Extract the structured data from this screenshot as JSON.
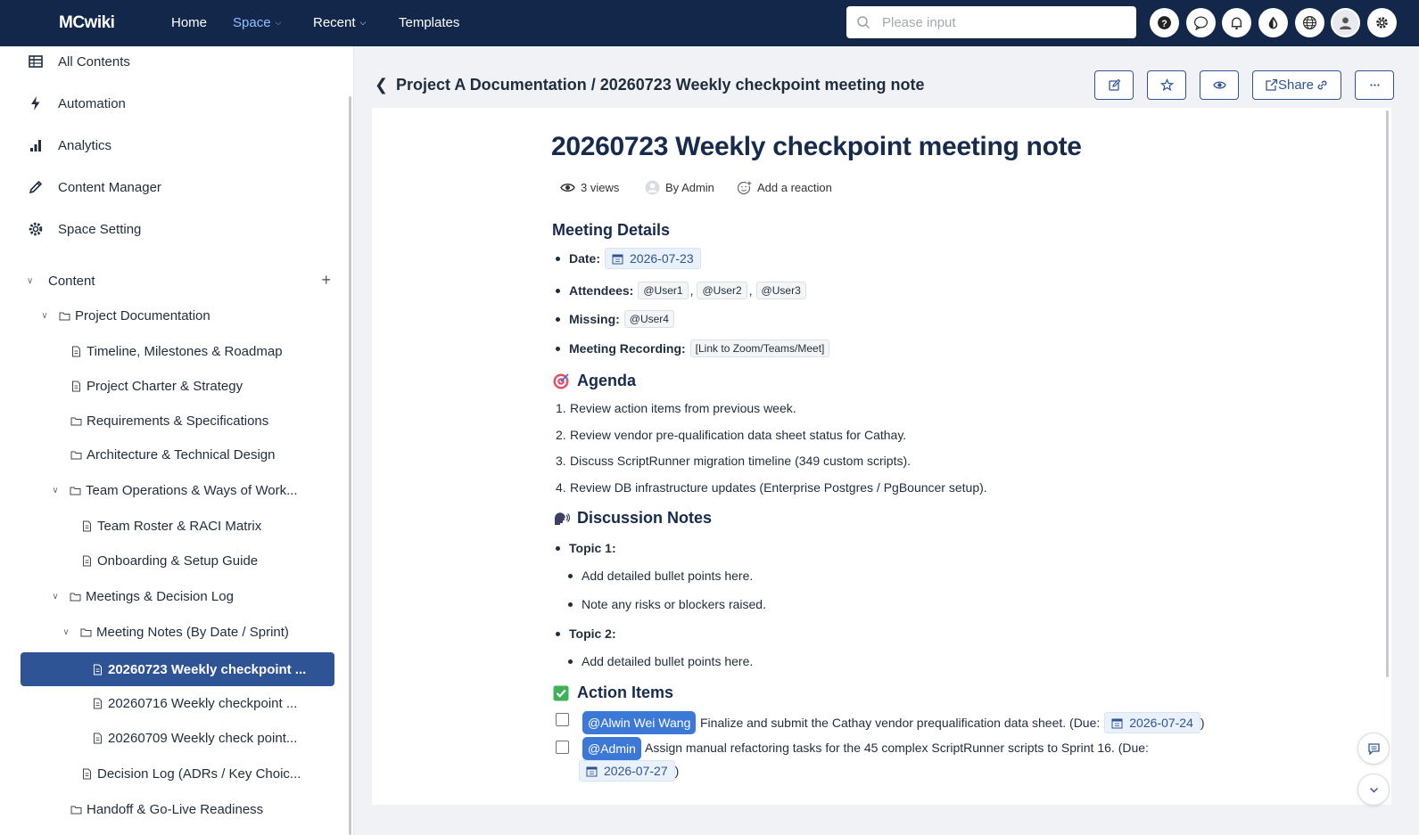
{
  "app": {
    "logo": "MCwiki"
  },
  "nav": {
    "home": "Home",
    "space": "Space",
    "recent": "Recent",
    "templates": "Templates"
  },
  "search": {
    "placeholder": "Please input"
  },
  "topbar_icons": [
    "help-icon",
    "chat-bubble-icon",
    "bell-icon",
    "theme-drop-icon",
    "globe-icon",
    "user-avatar",
    "gear-icon"
  ],
  "sidebar": {
    "menu": [
      {
        "label": "All Contents",
        "icon": "table-icon"
      },
      {
        "label": "Automation",
        "icon": "lightning-icon"
      },
      {
        "label": "Analytics",
        "icon": "bar-chart-icon"
      },
      {
        "label": "Content Manager",
        "icon": "pencil-icon"
      },
      {
        "label": "Space Setting",
        "icon": "gear-icon"
      }
    ],
    "content_header": "Content",
    "tree": [
      {
        "label": "Project Documentation",
        "type": "folder"
      },
      {
        "label": "Timeline, Milestones & Roadmap",
        "type": "page"
      },
      {
        "label": "Project Charter & Strategy",
        "type": "page"
      },
      {
        "label": "Requirements & Specifications",
        "type": "folder"
      },
      {
        "label": "Architecture & Technical Design",
        "type": "folder"
      },
      {
        "label": "Team Operations & Ways of Work...",
        "type": "folder"
      },
      {
        "label": "Team Roster & RACI Matrix",
        "type": "page"
      },
      {
        "label": "Onboarding & Setup Guide",
        "type": "page"
      },
      {
        "label": "Meetings & Decision Log",
        "type": "folder"
      },
      {
        "label": "Meeting Notes (By Date / Sprint)",
        "type": "folder"
      },
      {
        "label": "20260723 Weekly checkpoint ...",
        "type": "page",
        "selected": true
      },
      {
        "label": "20260716 Weekly checkpoint ...",
        "type": "page"
      },
      {
        "label": "20260709 Weekly check point...",
        "type": "page"
      },
      {
        "label": "Decision Log (ADRs / Key Choic...",
        "type": "page"
      },
      {
        "label": "Handoff & Go-Live Readiness",
        "type": "folder"
      }
    ]
  },
  "breadcrumb": "Project A Documentation / 20260723 Weekly checkpoint meeting note",
  "actions": {
    "share": "Share"
  },
  "doc": {
    "title": "20260723 Weekly checkpoint meeting note",
    "views": "3 views",
    "author": "By Admin",
    "reaction": "Add a reaction",
    "meeting_details": {
      "heading": "Meeting Details",
      "date_label": "Date:",
      "date": "2026-07-23",
      "attendees_label": "Attendees:",
      "attendees": [
        "@User1",
        "@User2",
        "@User3"
      ],
      "missing_label": "Missing:",
      "missing": "@User4",
      "recording_label": "Meeting Recording:",
      "recording": "[Link to Zoom/Teams/Meet]"
    },
    "agenda": {
      "heading": "Agenda",
      "items": [
        "Review action items from previous week.",
        "Review vendor pre-qualification data sheet status for Cathay.",
        "Discuss ScriptRunner migration timeline (349 custom scripts).",
        "Review DB infrastructure updates (Enterprise Postgres / PgBouncer setup)."
      ]
    },
    "discussion": {
      "heading": "Discussion Notes",
      "topic1": "Topic 1:",
      "topic1_items": [
        "Add detailed bullet points here.",
        "Note any risks or blockers raised."
      ],
      "topic2": "Topic 2:",
      "topic2_items": [
        "Add detailed bullet points here."
      ]
    },
    "action_items": {
      "heading": "Action Items",
      "items": [
        {
          "assignee": "@Alwin Wei Wang",
          "text": "Finalize and submit the Cathay vendor prequalification data sheet. (Due:",
          "due": "2026-07-24",
          "close": ")",
          "done": false
        },
        {
          "assignee": "@Admin",
          "text": "Assign manual refactoring tasks for the 45 complex ScriptRunner scripts to Sprint 16. (Due:",
          "due": "2026-07-27",
          "close": ")",
          "done": false
        }
      ]
    }
  },
  "colors": {
    "topbar": "#12274a",
    "accent": "#2f5496",
    "selected_bg": "#2f5496",
    "pill": "#3c79d6"
  }
}
